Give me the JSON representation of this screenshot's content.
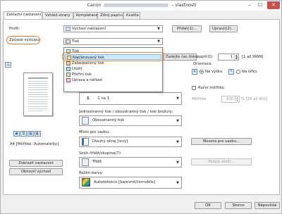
{
  "window": {
    "title_left": "Canon",
    "title_right": "– vlastnosti",
    "close_label": "✕",
    "minimize_label": "–",
    "maximize_label": "☐"
  },
  "tabs": [
    {
      "label": "Základní nastavení"
    },
    {
      "label": "Vzhled strany"
    },
    {
      "label": "Kompletace"
    },
    {
      "label": "Zdroj papíru"
    },
    {
      "label": "Kvalita"
    }
  ],
  "profile": {
    "label": "Profil:",
    "value": "Výchozí nastavení",
    "add_button": "Přidat(1)...",
    "edit_button": "Upravit(2)..."
  },
  "output": {
    "label": "Způsob výstupu:",
    "value": "Tisk"
  },
  "output_dropdown": {
    "items": [
      {
        "label": "Tisk",
        "icon": "print-icon"
      },
      {
        "label": "Naplánovaný tisk",
        "icon": "scheduled-print-icon",
        "selected": true
      },
      {
        "label": "Zabezpečený tisk",
        "icon": "secure-print-icon"
      },
      {
        "label": "Uložit",
        "icon": "save-icon"
      },
      {
        "label": "Přeřtní tisk",
        "icon": "forward-print-icon"
      },
      {
        "label": "Úprava a náhled",
        "icon": "edit-preview-icon"
      }
    ]
  },
  "set_time_button": "Zadejte čas tisku...",
  "copies": {
    "label": "kopií(Q):",
    "value": "1",
    "range": "[1 až 9999]"
  },
  "orientation": {
    "label": "Orientace",
    "portrait": "Na výšku",
    "landscape": "Na šířku"
  },
  "manual_scale": {
    "label": "Ruční měřítko",
    "scale_label": "Měřítko:",
    "value": "100",
    "range": "% [25 až 400]"
  },
  "pages_per_sheet": {
    "value": "1 na 1",
    "number": "1"
  },
  "duplex": {
    "label": "Jednostranný tisk / oboustranný tisk / tisk brožury:",
    "value": "Oboustranný tisk"
  },
  "binding": {
    "label": "Místo pro vazbu:",
    "value": "Dlouhý okraj [levý]",
    "margin_button": "Mezera pro vazbu..."
  },
  "staple": {
    "label": "Sešít./třídit/skupina(7):",
    "value": "Třídit",
    "staple_button": "Pozice sešití..."
  },
  "color_mode": {
    "label": "Režim barvy:",
    "value": "Autodetekce [barevně/černobíle]"
  },
  "preview": {
    "caption": "A4 [Měřítko: Automaticky]"
  },
  "left_buttons": {
    "show_settings": "Zobrazit nastavení",
    "restore_defaults": "Obnovit výchozí"
  },
  "dialog": {
    "ok": "OK",
    "cancel": "Storno",
    "help": "Nápověda"
  },
  "colors": {
    "accent": "#f07c1e",
    "selection": "#cde8ff",
    "close": "#c7504a"
  }
}
